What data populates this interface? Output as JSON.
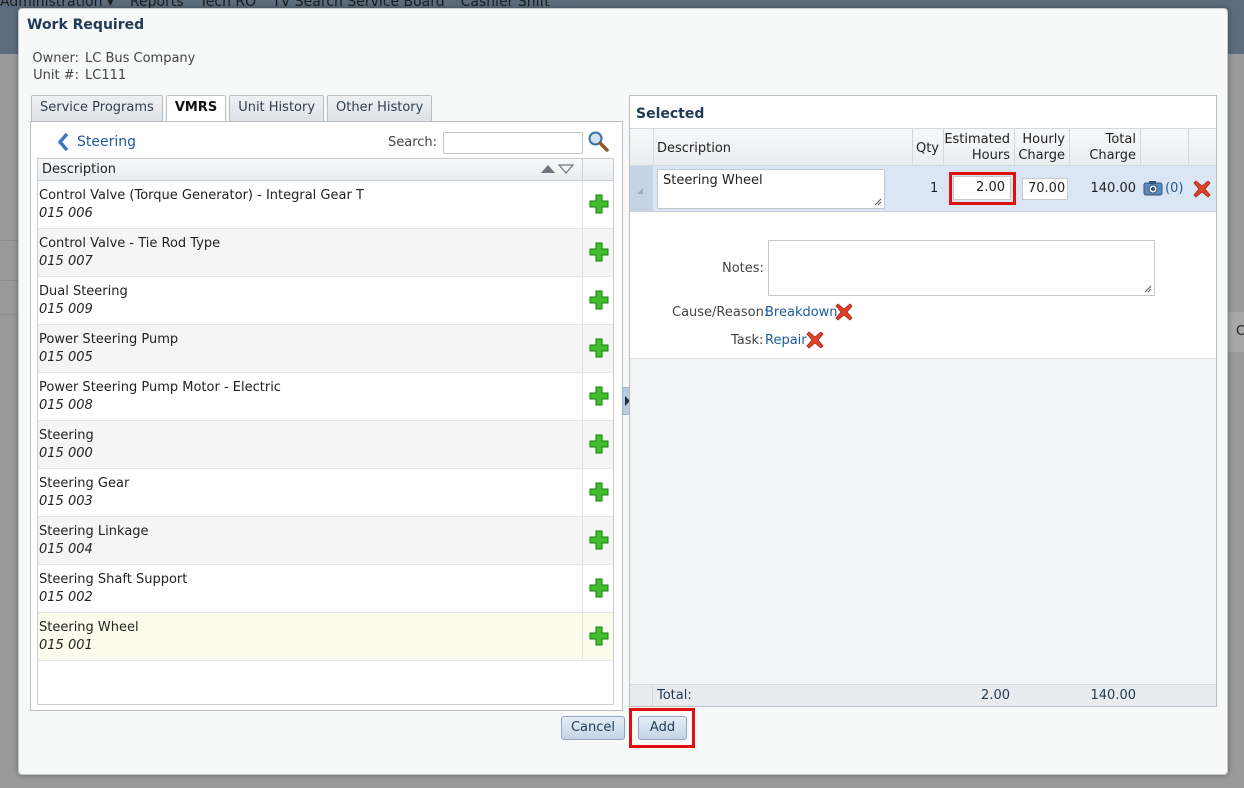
{
  "background": {
    "menu": [
      "Administration ▾",
      "Reports",
      "Tech RO",
      "TV Search Service Board",
      "Cashier Shift"
    ],
    "right_edge_char": "C"
  },
  "dialog": {
    "title": "Work Required",
    "owner_label": "Owner:",
    "owner_value": "LC Bus Company",
    "unit_label": "Unit #:",
    "unit_value": "LC111"
  },
  "tabs": [
    {
      "label": "Service Programs",
      "active": false
    },
    {
      "label": "VMRS",
      "active": true
    },
    {
      "label": "Unit History",
      "active": false
    },
    {
      "label": "Other History",
      "active": false
    }
  ],
  "vmrs": {
    "breadcrumb": "Steering",
    "search_label": "Search:",
    "search_value": "",
    "column_header": "Description",
    "rows": [
      {
        "name": "Control Valve (Torque Generator) - Integral Gear T",
        "code": "015 006"
      },
      {
        "name": "Control Valve - Tie Rod Type",
        "code": "015 007"
      },
      {
        "name": "Dual Steering",
        "code": "015 009"
      },
      {
        "name": "Power Steering Pump",
        "code": "015 005"
      },
      {
        "name": "Power Steering Pump Motor - Electric",
        "code": "015 008"
      },
      {
        "name": "Steering",
        "code": "015 000"
      },
      {
        "name": "Steering Gear",
        "code": "015 003"
      },
      {
        "name": "Steering Linkage",
        "code": "015 004"
      },
      {
        "name": "Steering Shaft Support",
        "code": "015 002"
      },
      {
        "name": "Steering Wheel",
        "code": "015 001"
      }
    ]
  },
  "selected": {
    "title": "Selected",
    "headers": {
      "description": "Description",
      "qty": "Qty",
      "hours_line1": "Estimated",
      "hours_line2": "Hours",
      "rate_line1": "Hourly",
      "rate_line2": "Charge",
      "total_line1": "Total",
      "total_line2": "Charge"
    },
    "row": {
      "description": "Steering Wheel",
      "qty": "1",
      "hours": "2.00",
      "rate": "70.00",
      "total": "140.00",
      "attachments": "(0)"
    },
    "notes_label": "Notes:",
    "notes_value": "",
    "cause_label": "Cause/Reason:",
    "cause_value": "Breakdown",
    "task_label": "Task:",
    "task_value": "Repair",
    "footer": {
      "label": "Total:",
      "hours": "2.00",
      "charge": "140.00"
    }
  },
  "buttons": {
    "cancel": "Cancel",
    "add": "Add"
  },
  "colors": {
    "highlight": "#e01010",
    "link": "#1f5a9a",
    "title": "#1f3a57",
    "selected_row": "#dbe6f4"
  }
}
